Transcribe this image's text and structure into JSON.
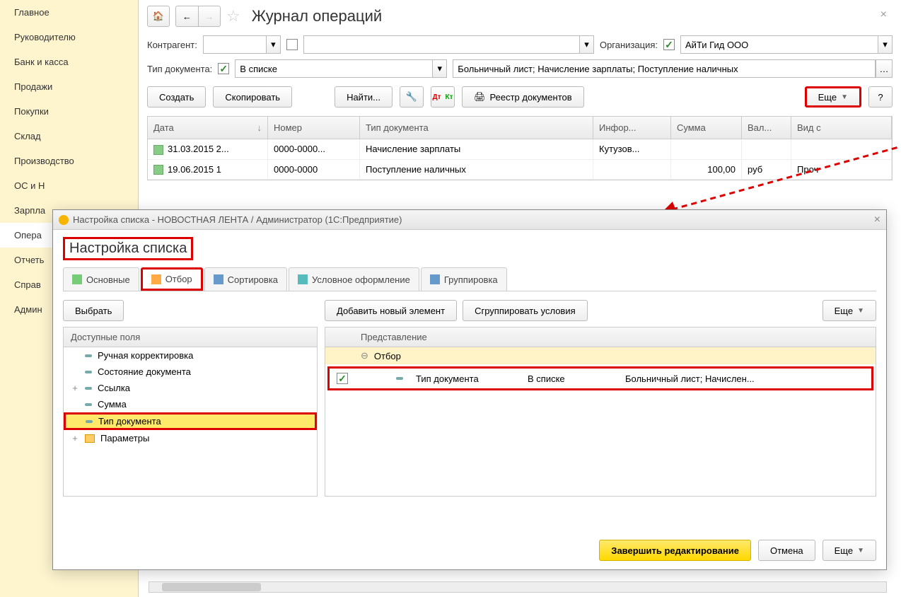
{
  "sidebar": {
    "items": [
      "Главное",
      "Руководителю",
      "Банк и касса",
      "Продажи",
      "Покупки",
      "Склад",
      "Производство",
      "ОС и Н",
      "Зарпла",
      "Опера",
      "Отчеть",
      "Справ",
      "Админ"
    ]
  },
  "header": {
    "title": "Журнал операций"
  },
  "filters": {
    "counterparty_label": "Контрагент:",
    "org_label": "Организация:",
    "org_value": "АйТи Гид ООО",
    "doctype_label": "Тип документа:",
    "doctype_mode": "В списке",
    "doctype_value": "Больничный лист; Начисление зарплаты; Поступление наличных"
  },
  "toolbar": {
    "create": "Создать",
    "copy": "Скопировать",
    "find": "Найти...",
    "registry": "Реестр документов",
    "more": "Еще",
    "help": "?"
  },
  "table": {
    "cols": {
      "date": "Дата",
      "num": "Номер",
      "type": "Тип документа",
      "info": "Инфор...",
      "sum": "Сумма",
      "cur": "Вал...",
      "kind": "Вид с"
    },
    "rows": [
      {
        "date": "31.03.2015 2...",
        "num": "0000-0000...",
        "type": "Начисление зарплаты",
        "info": "Кутузов...",
        "sum": "",
        "cur": "",
        "kind": ""
      },
      {
        "date": "19.06.2015 1",
        "num": "0000-0000",
        "type": "Поступление наличных",
        "info": "",
        "sum": "100,00",
        "cur": "руб",
        "kind": "Проч"
      }
    ]
  },
  "dialog": {
    "window_title": "Настройка списка - НОВОСТНАЯ ЛЕНТА / Администратор  (1С:Предприятие)",
    "heading": "Настройка списка",
    "tabs": [
      "Основные",
      "Отбор",
      "Сортировка",
      "Условное оформление",
      "Группировка"
    ],
    "left": {
      "choose": "Выбрать",
      "header": "Доступные поля",
      "items": [
        {
          "label": "Ручная корректировка",
          "exp": ""
        },
        {
          "label": "Состояние документа",
          "exp": ""
        },
        {
          "label": "Ссылка",
          "exp": "+"
        },
        {
          "label": "Сумма",
          "exp": ""
        },
        {
          "label": "Тип документа",
          "exp": "",
          "sel": true
        },
        {
          "label": "Параметры",
          "exp": "+",
          "folder": true
        }
      ]
    },
    "right": {
      "add": "Добавить новый элемент",
      "group": "Сгруппировать условия",
      "more": "Еще",
      "header": "Представление",
      "root": "Отбор",
      "row": {
        "field": "Тип документа",
        "cond": "В списке",
        "val": "Больничный лист; Начислен..."
      }
    },
    "footer": {
      "finish": "Завершить редактирование",
      "cancel": "Отмена",
      "more": "Еще"
    }
  }
}
